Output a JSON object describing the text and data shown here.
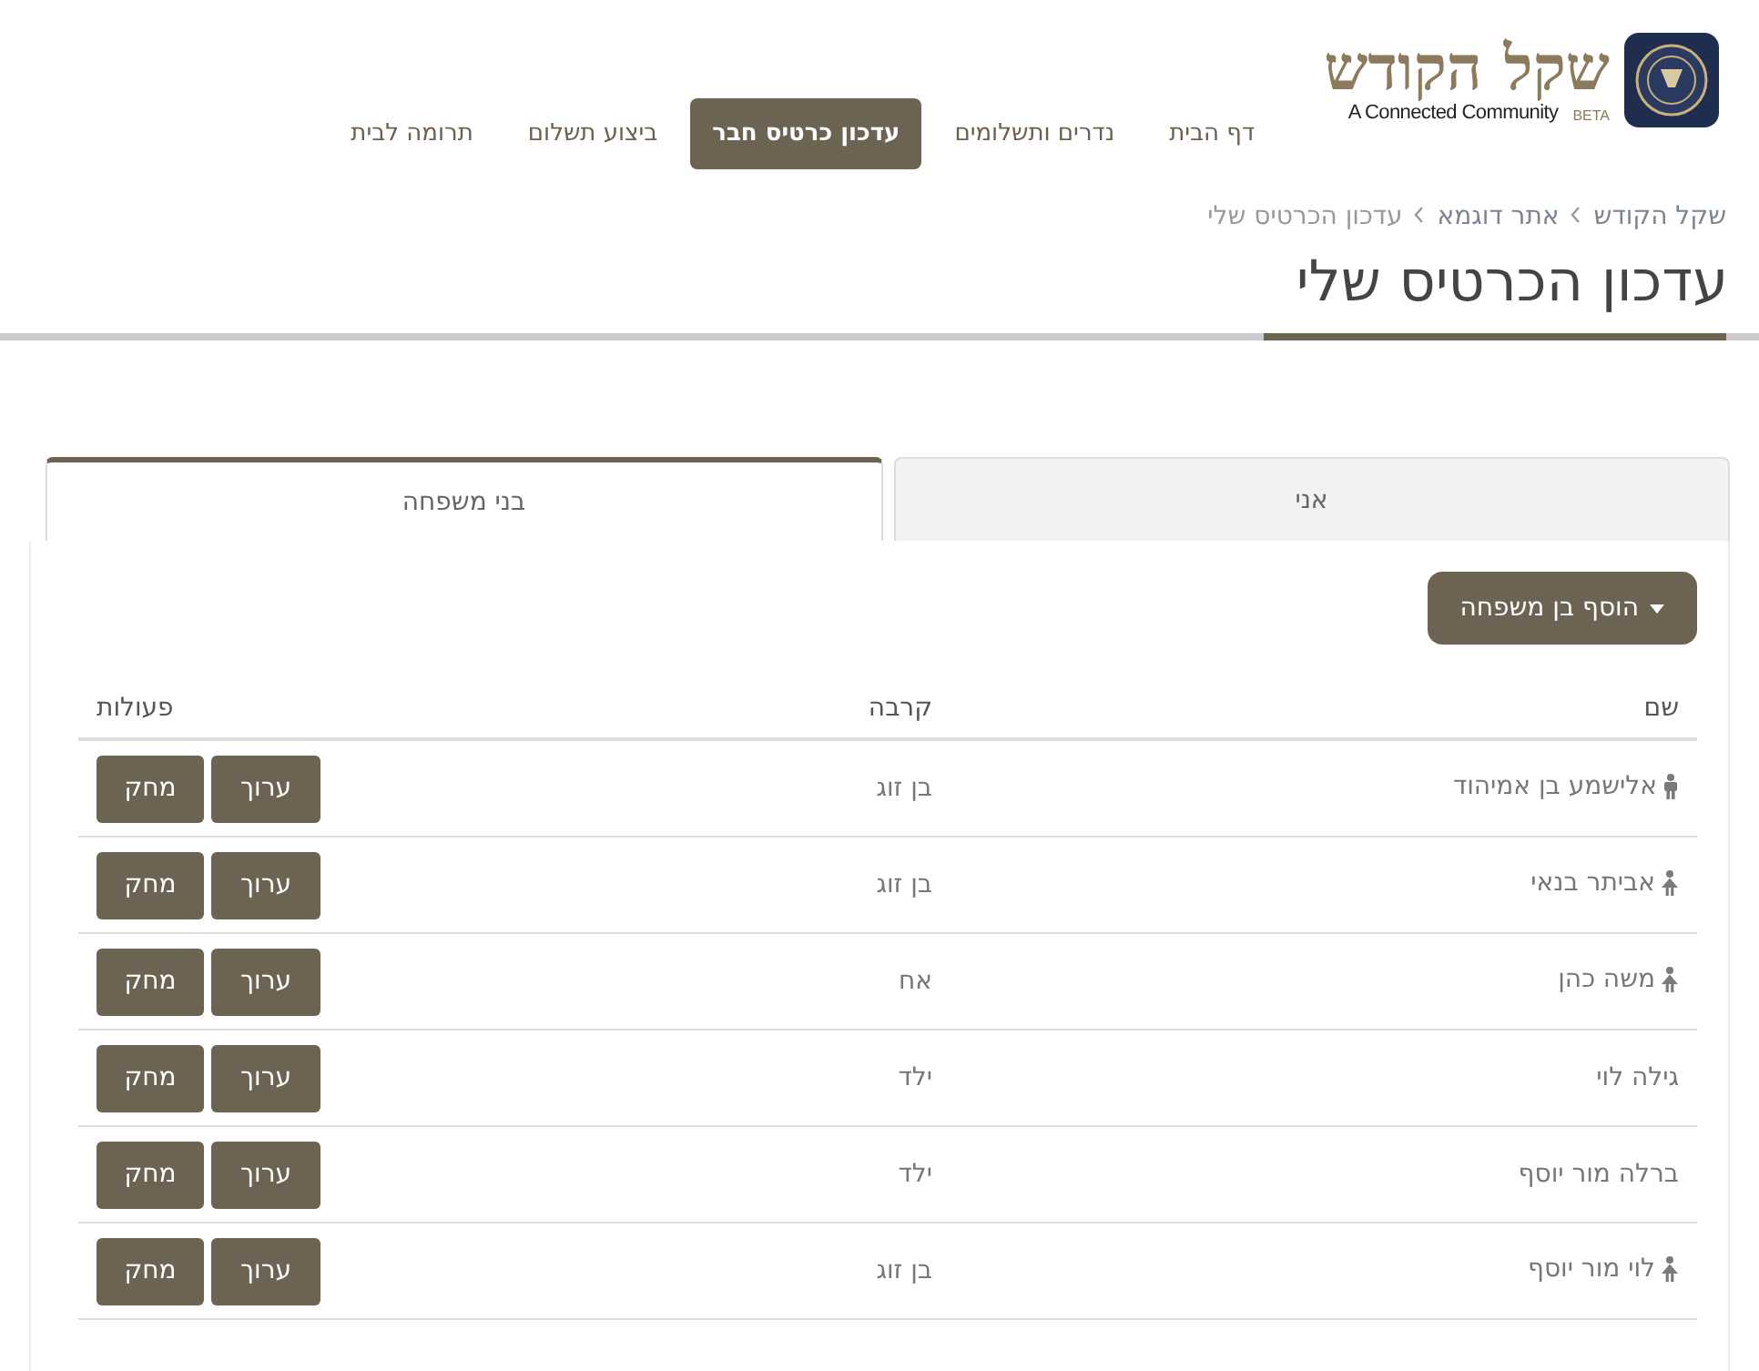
{
  "logo": {
    "title": "שקל הקודש",
    "tagline": "A Connected Community",
    "badge": "BETA"
  },
  "nav": [
    {
      "label": "דף הבית",
      "selected": false
    },
    {
      "label": "נדרים ותשלומים",
      "selected": false
    },
    {
      "label": "עדכון כרטיס חבר",
      "selected": true
    },
    {
      "label": "ביצוע תשלום",
      "selected": false
    },
    {
      "label": "תרומה לבית",
      "selected": false
    }
  ],
  "breadcrumb": [
    "שקל הקודש",
    "אתר דוגמא",
    "עדכון הכרטיס שלי"
  ],
  "page_title": "עדכון הכרטיס שלי",
  "tabs": [
    {
      "label": "אני",
      "selected": false
    },
    {
      "label": "בני משפחה",
      "selected": true
    }
  ],
  "add_button": "הוסף בן משפחה",
  "table": {
    "columns": [
      "שם",
      "קרבה",
      "פעולות"
    ],
    "rows": [
      {
        "name": "אלישמע בן אמיהוד",
        "kind": "male",
        "relation": "בן זוג",
        "edit": "ערוך",
        "delete": "מחק"
      },
      {
        "name": "אביתר בנאי",
        "kind": "female",
        "relation": "בן זוג",
        "edit": "ערוך",
        "delete": "מחק"
      },
      {
        "name": "משה כהן",
        "kind": "female",
        "relation": "אח",
        "edit": "ערוך",
        "delete": "מחק"
      },
      {
        "name": "גילה לוי",
        "kind": "none",
        "relation": "ילד",
        "edit": "ערוך",
        "delete": "מחק"
      },
      {
        "name": "ברלה מור יוסף",
        "kind": "none",
        "relation": "ילד",
        "edit": "ערוך",
        "delete": "מחק"
      },
      {
        "name": "לוי מור יוסף",
        "kind": "female",
        "relation": "בן זוג",
        "edit": "ערוך",
        "delete": "מחק"
      }
    ]
  }
}
